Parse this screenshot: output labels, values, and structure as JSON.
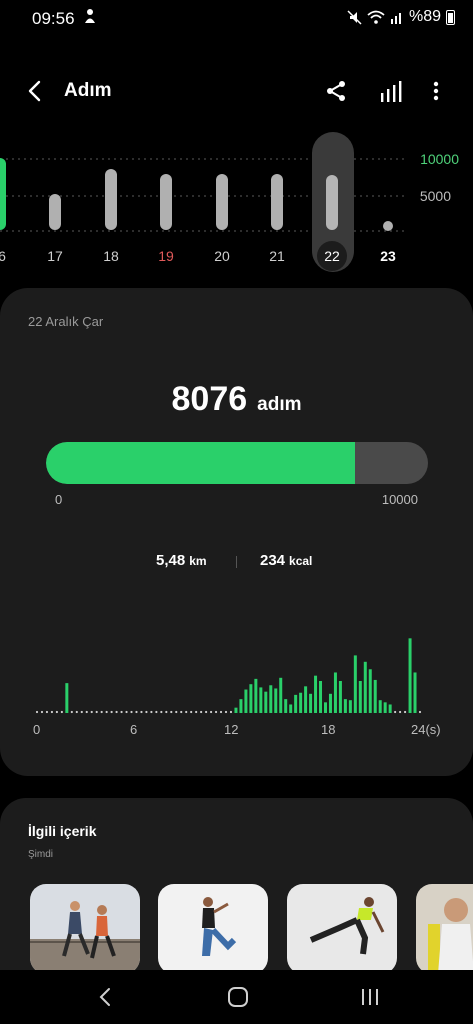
{
  "status_bar": {
    "time": "09:56",
    "battery": "%89",
    "icons": [
      "notification-icon",
      "mute-icon",
      "wifi-icon",
      "signal-icon",
      "battery-icon"
    ]
  },
  "header": {
    "title": "Adım",
    "icons": [
      "back-arrow-icon",
      "share-icon",
      "bar-chart-icon",
      "more-vert-icon"
    ]
  },
  "week_chart": {
    "goal_labels": [
      "10000",
      "5000"
    ],
    "days": [
      {
        "label": "6"
      },
      {
        "label": "17"
      },
      {
        "label": "18"
      },
      {
        "label": "19",
        "highlight": "sunday"
      },
      {
        "label": "20"
      },
      {
        "label": "21"
      },
      {
        "label": "22",
        "selected": true
      },
      {
        "label": "23",
        "today": true
      }
    ]
  },
  "summary": {
    "date": "22 Aralık Çar",
    "steps": "8076",
    "steps_unit": "adım",
    "goal_min": "0",
    "goal_max": "10000",
    "progress_fraction": 0.8076,
    "distance_value": "5,48",
    "distance_unit": "km",
    "calories_value": "234",
    "calories_unit": "kcal"
  },
  "chart_data": {
    "type": "bar",
    "title": "",
    "x_tick_labels": [
      "0",
      "6",
      "12",
      "18",
      "24(s)"
    ],
    "bars_per_hour": 2,
    "values": [
      0,
      0,
      0,
      0,
      0,
      0,
      28,
      0,
      0,
      0,
      0,
      0,
      0,
      0,
      0,
      0,
      0,
      0,
      0,
      0,
      0,
      0,
      0,
      0,
      0,
      0,
      0,
      0,
      0,
      0,
      0,
      0,
      0,
      0,
      0,
      0,
      0,
      0,
      0,
      0,
      5,
      13,
      22,
      27,
      32,
      24,
      20,
      26,
      23,
      33,
      13,
      8,
      17,
      19,
      25,
      18,
      35,
      30,
      10,
      18,
      38,
      30,
      13,
      12,
      54,
      30,
      48,
      41,
      31,
      12,
      10,
      8,
      0,
      0,
      0,
      70,
      38,
      0
    ],
    "max": 75,
    "grid": false,
    "colors": {
      "bar": "#2ad06a",
      "baseline_dot": "#cfcfcf"
    }
  },
  "related": {
    "title": "İlgili içerik",
    "subtitle": "Şimdi",
    "thumbnails": [
      {
        "name": "runners-thumbnail"
      },
      {
        "name": "stretch-thumbnail"
      },
      {
        "name": "lunge-thumbnail"
      },
      {
        "name": "gym-thumbnail"
      }
    ]
  },
  "nav_bar": {
    "icons": [
      "nav-back-icon",
      "nav-home-icon",
      "nav-recents-icon"
    ]
  },
  "colors": {
    "accent": "#2ad06a",
    "goal_label": "#4fd27a",
    "sunday": "#e05a5a",
    "card": "#1c1c1c"
  }
}
